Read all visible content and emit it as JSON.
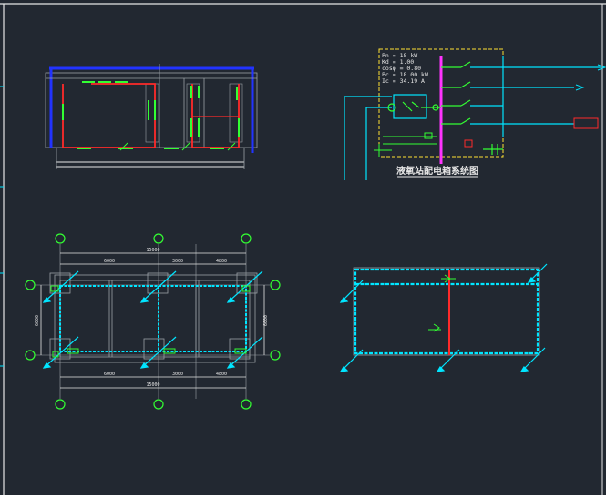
{
  "colors": {
    "background": "#222831",
    "cyan": "#00e5ff",
    "green": "#33ff33",
    "red": "#ff2a2a",
    "blue": "#2233ff",
    "magenta": "#ff33ff",
    "yellow": "#ffe033",
    "white": "#e6e6e6",
    "grey": "#9aa0a6"
  },
  "system_diagram": {
    "title": "液氧站配电箱系统图",
    "params": [
      "Pn = 18 kW",
      "Kd = 1.00",
      "cosφ = 0.80",
      "Pc = 18.00 kW",
      "Ic = 34.19 A"
    ]
  },
  "floor_plan": {
    "overall_dim": "15000",
    "segments": [
      "6000",
      "3000",
      "4800"
    ],
    "height_dim": "6000"
  }
}
